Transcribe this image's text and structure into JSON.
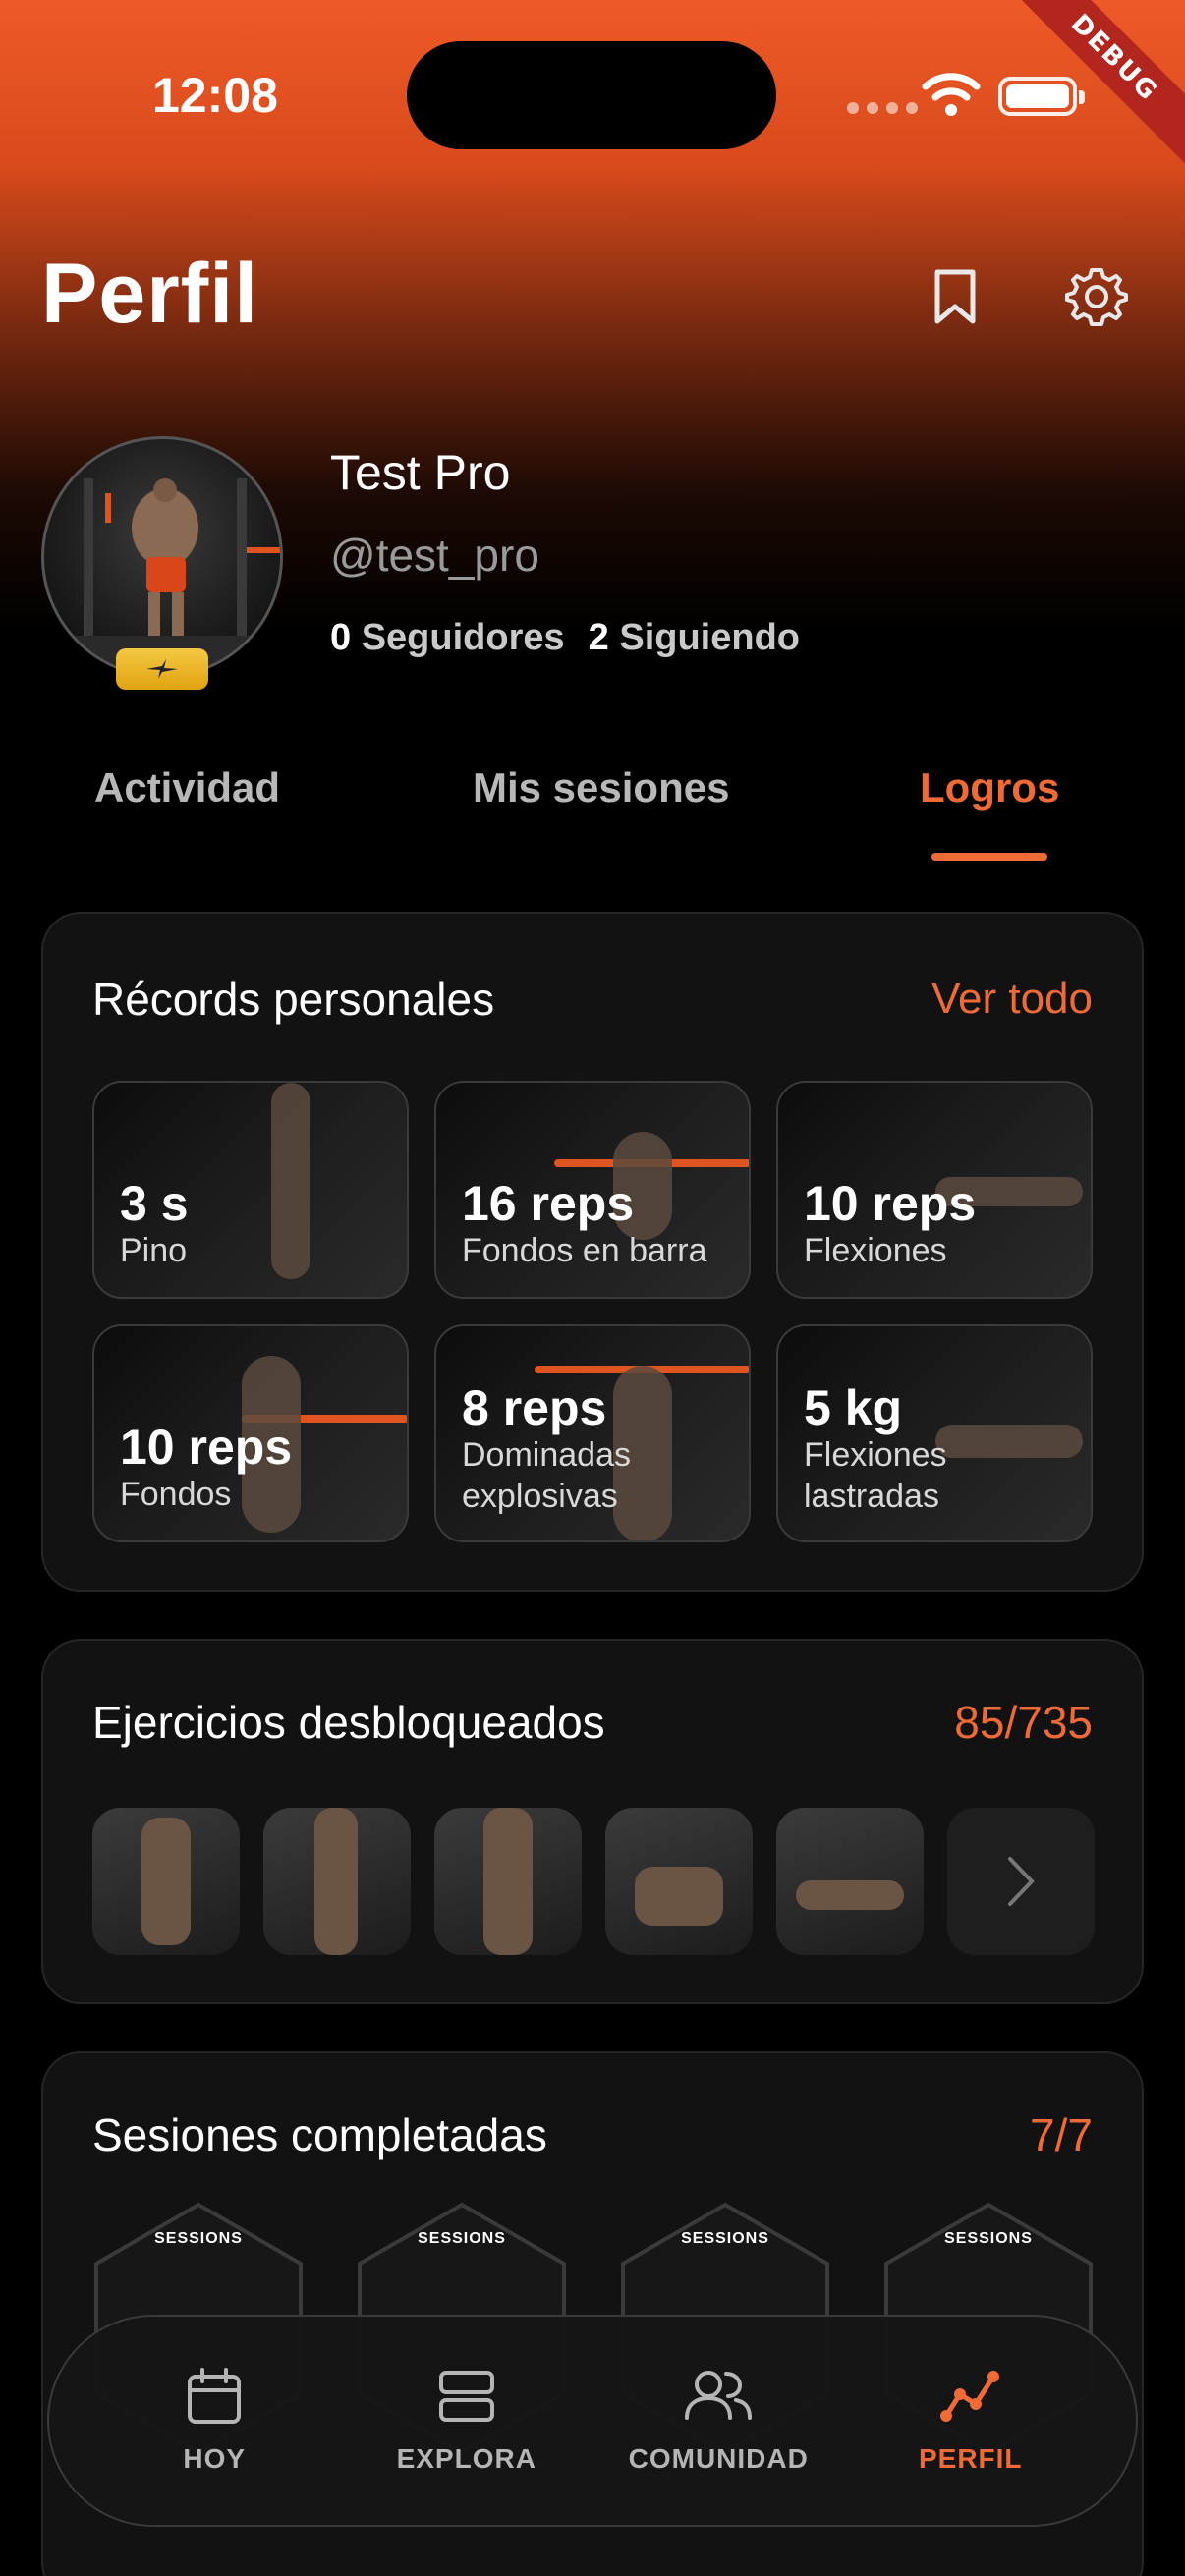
{
  "status_bar": {
    "time": "12:08"
  },
  "debug_label": "DEBUG",
  "header": {
    "title": "Perfil"
  },
  "profile": {
    "name": "Test Pro",
    "handle": "@test_pro",
    "followers_count": "0",
    "followers_label": "Seguidores",
    "following_count": "2",
    "following_label": "Siguiendo"
  },
  "tabs": [
    {
      "label": "Actividad",
      "active": false
    },
    {
      "label": "Mis sesiones",
      "active": false
    },
    {
      "label": "Logros",
      "active": true
    }
  ],
  "records": {
    "title": "Récords personales",
    "link": "Ver todo",
    "items": [
      {
        "value": "3 s",
        "label": "Pino"
      },
      {
        "value": "16 reps",
        "label": "Fondos en barra"
      },
      {
        "value": "10 reps",
        "label": "Flexiones"
      },
      {
        "value": "10 reps",
        "label": "Fondos"
      },
      {
        "value": "8 reps",
        "label": "Dominadas explosivas"
      },
      {
        "value": "5 kg",
        "label": "Flexiones lastradas"
      }
    ]
  },
  "exercises": {
    "title": "Ejercicios desbloqueados",
    "count": "85/735"
  },
  "sessions": {
    "title": "Sesiones completadas",
    "count": "7/7",
    "badge_label": "SESSIONS"
  },
  "bottom_nav": [
    {
      "label": "HOY",
      "icon": "calendar-icon",
      "active": false
    },
    {
      "label": "EXPLORA",
      "icon": "stack-icon",
      "active": false
    },
    {
      "label": "COMUNIDAD",
      "icon": "people-icon",
      "active": false
    },
    {
      "label": "PERFIL",
      "icon": "chart-icon",
      "active": true
    }
  ],
  "colors": {
    "accent": "#f06a35",
    "background": "#000000",
    "card": "#121212"
  }
}
